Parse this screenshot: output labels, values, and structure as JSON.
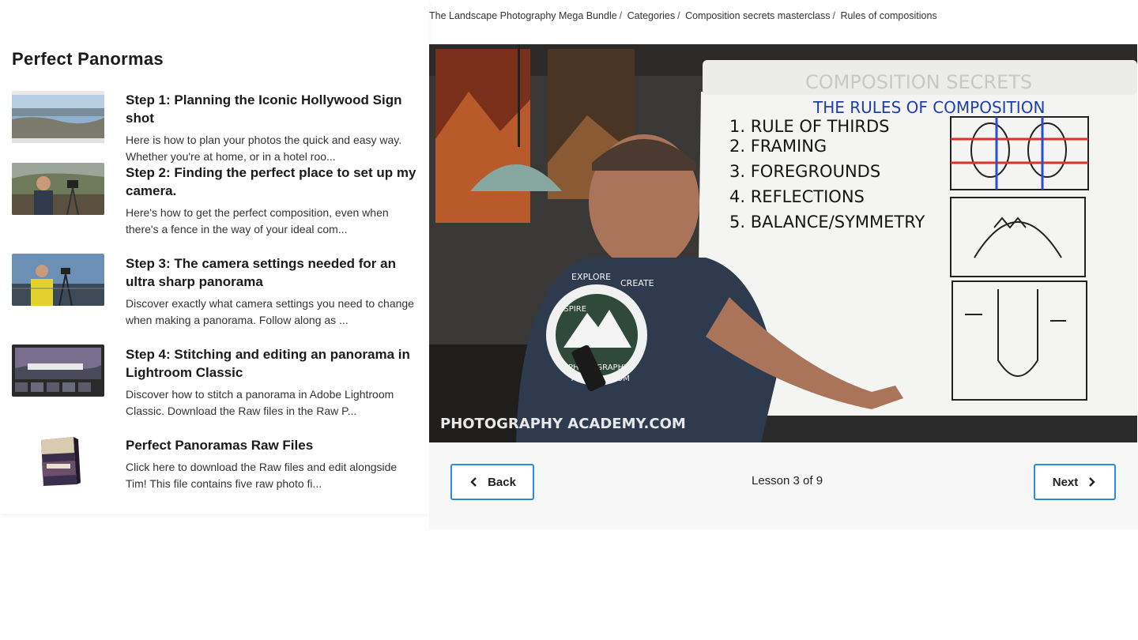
{
  "breadcrumb": {
    "items": [
      "The Landscape Photography Mega Bundle",
      "Categories",
      "Composition secrets masterclass"
    ],
    "current": "Rules of compositions"
  },
  "sidebar": {
    "title": "Perfect Panormas",
    "items": [
      {
        "title": "Step 1: Planning the Iconic Hollywood Sign shot",
        "desc": "Here is how to plan your photos the quick and easy way. Whether you're at home, or in a hotel roo..."
      },
      {
        "title": "Step 2: Finding the perfect place to set up my camera.",
        "desc": "Here's how to get the perfect composition, even when there's a fence in the way of your ideal com..."
      },
      {
        "title": "Step 3: The camera settings needed for an ultra sharp panorama",
        "desc": "Discover exactly what camera settings you need to change when making a panorama. Follow along as ..."
      },
      {
        "title": "Step 4: Stitching and editing an panorama in Lightroom Classic",
        "desc": "Discover how to stitch a panorama in Adobe Lightroom Classic. Download the Raw files in the Raw P..."
      },
      {
        "title": "Perfect Panoramas Raw Files",
        "desc": "Click here to download the Raw files and edit alongside Tim! This file contains five raw photo fi..."
      }
    ]
  },
  "video": {
    "whiteboard": {
      "header": "COMPOSITION SECRETS",
      "heading": "THE RULES OF COMPOSITION",
      "list": [
        "1. RULE OF THIRDS",
        "2. FRAMING",
        "3. FOREGROUNDS",
        "4. REFLECTIONS",
        "5. BALANCE/SYMMETRY"
      ]
    },
    "shirt_text": [
      "EXPLORE",
      "CREATE",
      "INSPIRE",
      "PHOTOGRAPHY",
      "ACADEMY.COM"
    ],
    "watermark": "PHOTOGRAPHY ACADEMY.COM"
  },
  "lesson_nav": {
    "back_label": "Back",
    "next_label": "Next",
    "lesson_text": "Lesson 3 of 9"
  },
  "colors": {
    "accent": "#2b8be0",
    "red_marker": "#e0302a",
    "blue_marker": "#2a4fc9"
  }
}
